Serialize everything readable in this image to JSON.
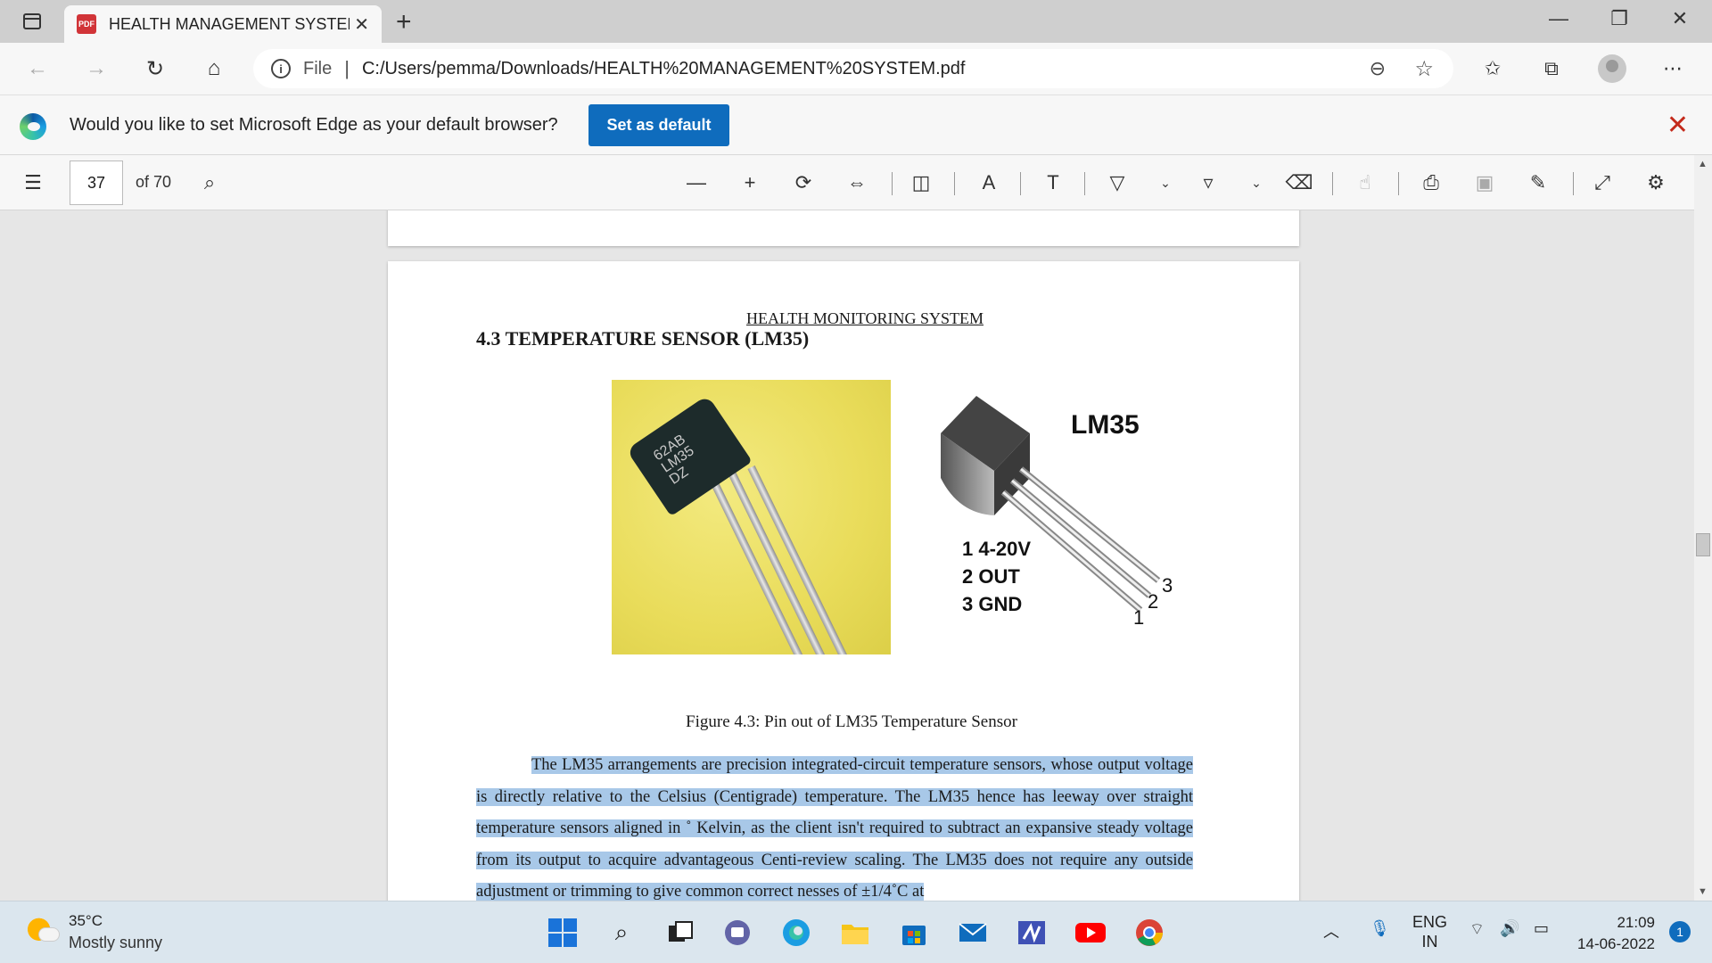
{
  "browser": {
    "tab_title": "HEALTH MANAGEMENT SYSTEM",
    "tab_icon_text": "PDF",
    "address_prefix": "File",
    "url": "C:/Users/pemma/Downloads/HEALTH%20MANAGEMENT%20SYSTEM.pdf"
  },
  "infobar": {
    "message": "Would you like to set Microsoft Edge as your default browser?",
    "button": "Set as default"
  },
  "pdf_toolbar": {
    "page_number": "37",
    "page_total": "of 70"
  },
  "document": {
    "running_header": "HEALTH MONITORING SYSTEM",
    "heading": "4.3 TEMPERATURE SENSOR (LM35)",
    "chip_marking": [
      "62AB",
      "LM35",
      "DZ"
    ],
    "diagram_title": "LM35",
    "pin_legend": [
      "1 4-20V",
      "2 OUT",
      "3 GND"
    ],
    "pin_numbers": [
      "1",
      "2",
      "3"
    ],
    "caption": "Figure 4.3: Pin out of LM35 Temperature Sensor",
    "paragraph": "The LM35 arrangements are precision integrated-circuit temperature sensors, whose output voltage is directly relative to the Celsius (Centigrade) temperature. The LM35 hence has leeway over straight temperature sensors aligned in ˚ Kelvin, as the client isn't required to subtract an expansive steady voltage from its output to acquire advantageous Centi-review scaling. The LM35 does not require any outside adjustment or trimming to give common correct nesses of ±1/4˚C at"
  },
  "taskbar": {
    "temperature": "35°C",
    "weather": "Mostly sunny",
    "lang_top": "ENG",
    "lang_bottom": "IN",
    "time": "21:09",
    "date": "14-06-2022",
    "notifications": "1"
  },
  "colors": {
    "accent": "#0f6cbd",
    "highlight": "#a8c8e8",
    "close_red": "#c42b1c"
  }
}
